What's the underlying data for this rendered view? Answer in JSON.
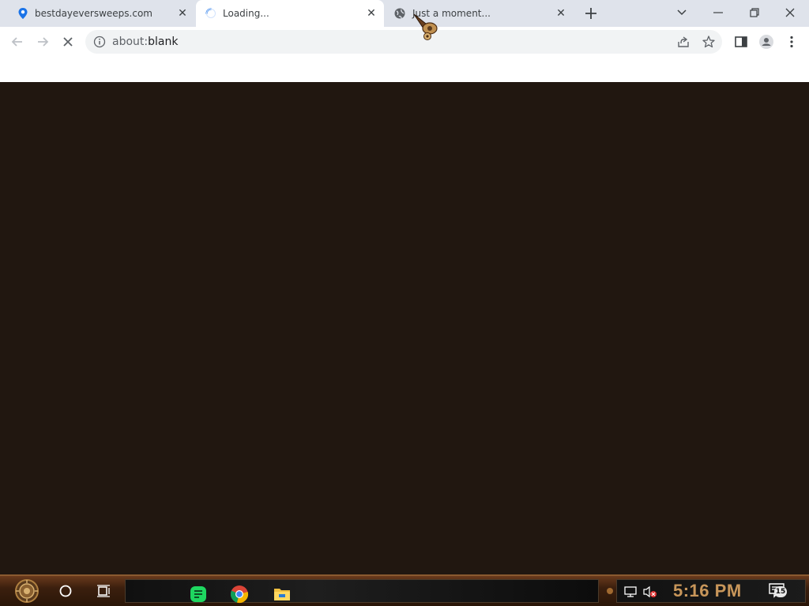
{
  "tabs": [
    {
      "title": "bestdayeversweeps.com",
      "icon": "location-pin-icon",
      "active": false
    },
    {
      "title": "Loading...",
      "icon": "loading-spinner-icon",
      "active": true
    },
    {
      "title": "Just a moment...",
      "icon": "globe-icon",
      "active": false
    }
  ],
  "toolbar": {
    "url_scheme": "about:",
    "url_path": "blank"
  },
  "taskbar": {
    "clock": "5:16 PM",
    "notification_count": "15"
  },
  "colors": {
    "page_background": "#211710",
    "tabstrip": "#dfe3eb",
    "clock": "#c8965a"
  }
}
